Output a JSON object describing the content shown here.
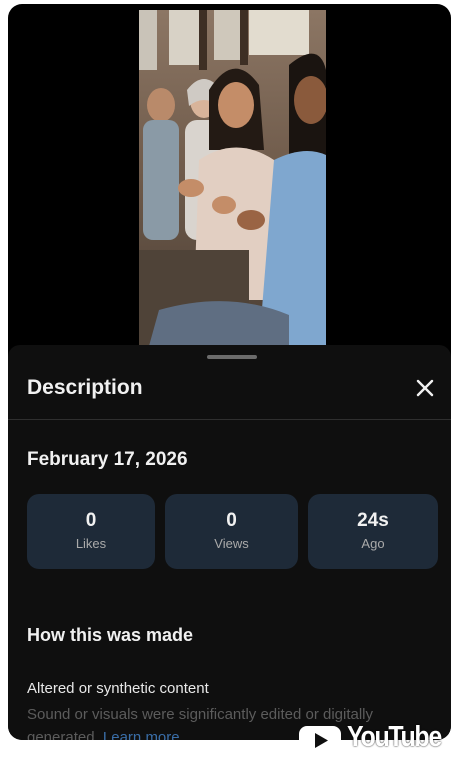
{
  "sheet": {
    "title": "Description",
    "date": "February 17, 2026",
    "stats": [
      {
        "value": "0",
        "label": "Likes"
      },
      {
        "value": "0",
        "label": "Views"
      },
      {
        "value": "24s",
        "label": "Ago"
      }
    ],
    "how_made_title": "How this was made",
    "altered_title": "Altered or synthetic content",
    "altered_desc_line1": "Sound or visuals were significantly edited or digitally",
    "altered_desc_line2": "generated.",
    "learn_more": "Learn more"
  },
  "watermark": {
    "text": "YouTube",
    "icon": "youtube-play-icon"
  },
  "icons": {
    "close": "close-icon"
  },
  "colors": {
    "sheet_bg": "#0f0f0f",
    "stat_card_bg": "#1e2a38",
    "link": "#3a6ea8"
  }
}
